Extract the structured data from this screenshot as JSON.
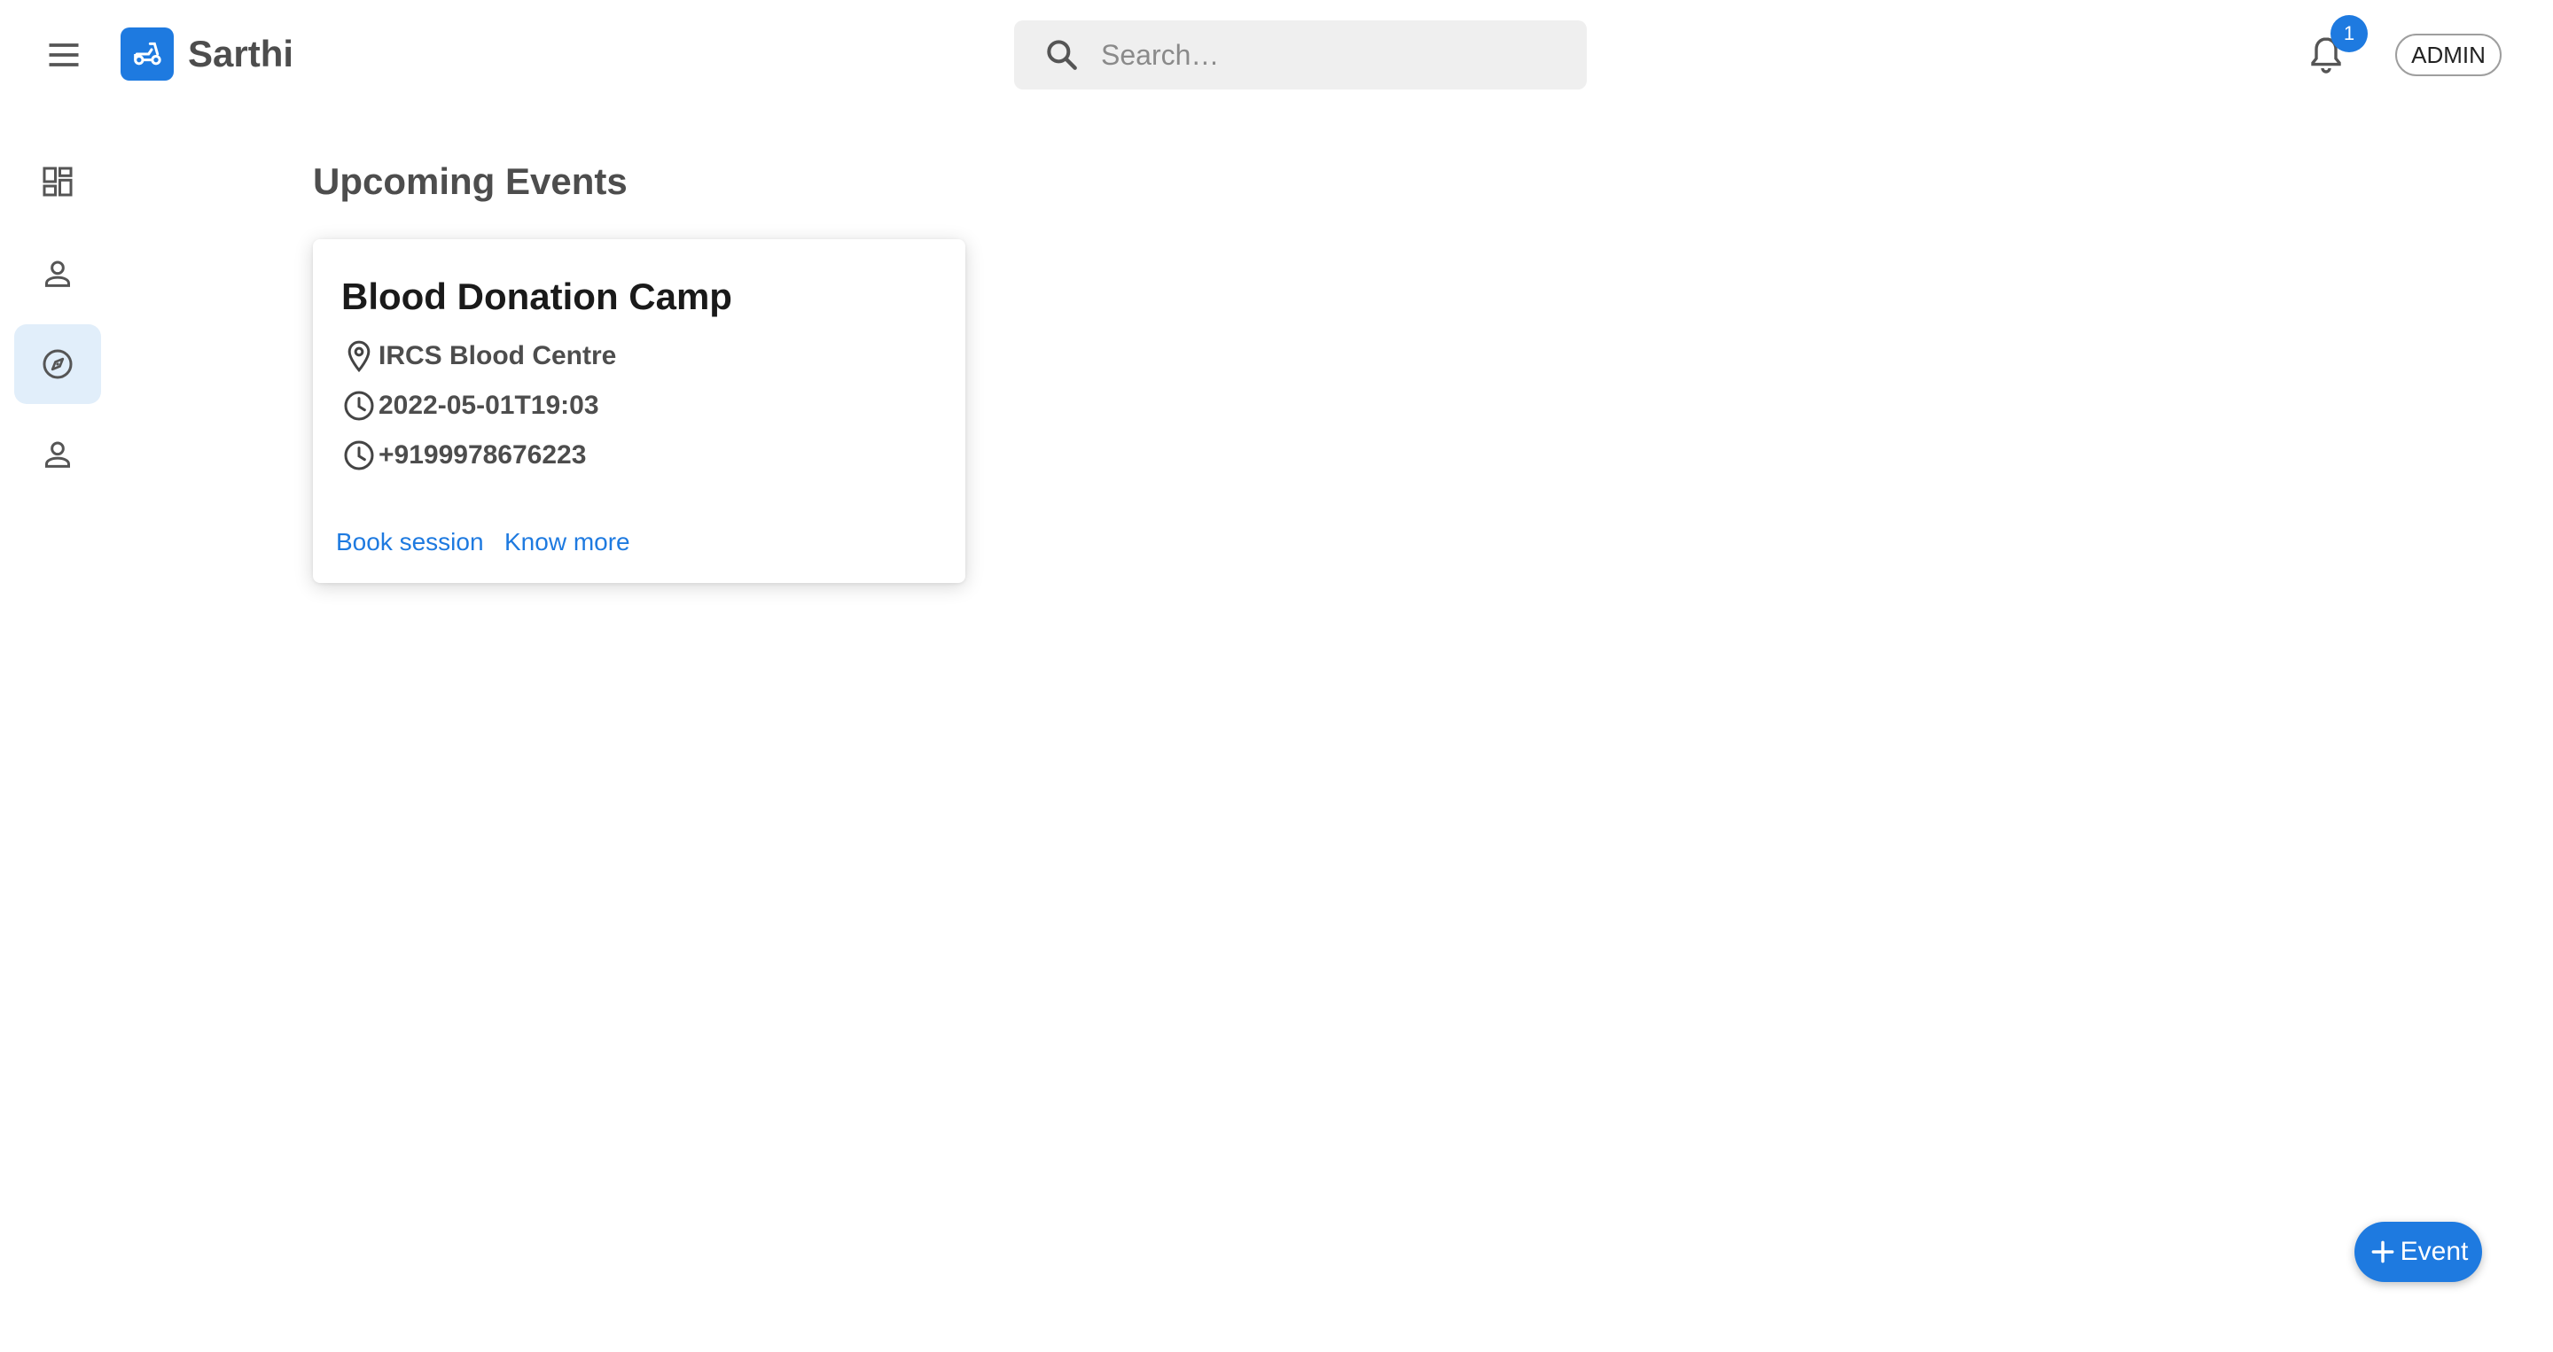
{
  "header": {
    "app_name": "Sarthi",
    "search_placeholder": "Search…",
    "notification_count": "1",
    "role_label": "ADMIN"
  },
  "sidebar": {
    "items": [
      {
        "icon": "dashboard-icon"
      },
      {
        "icon": "person-icon"
      },
      {
        "icon": "explore-icon",
        "active": true
      },
      {
        "icon": "person-icon"
      }
    ]
  },
  "main": {
    "title": "Upcoming Events",
    "events": [
      {
        "title": "Blood Donation Camp",
        "location": "IRCS Blood Centre",
        "datetime": "2022-05-01T19:03",
        "phone": "+9199978676223",
        "actions": [
          "Book session",
          "Know more"
        ]
      }
    ]
  },
  "fab": {
    "label": "Event"
  },
  "colors": {
    "primary": "#1e7ae0",
    "active_bg": "#e1eefa",
    "search_bg": "#efefef"
  }
}
